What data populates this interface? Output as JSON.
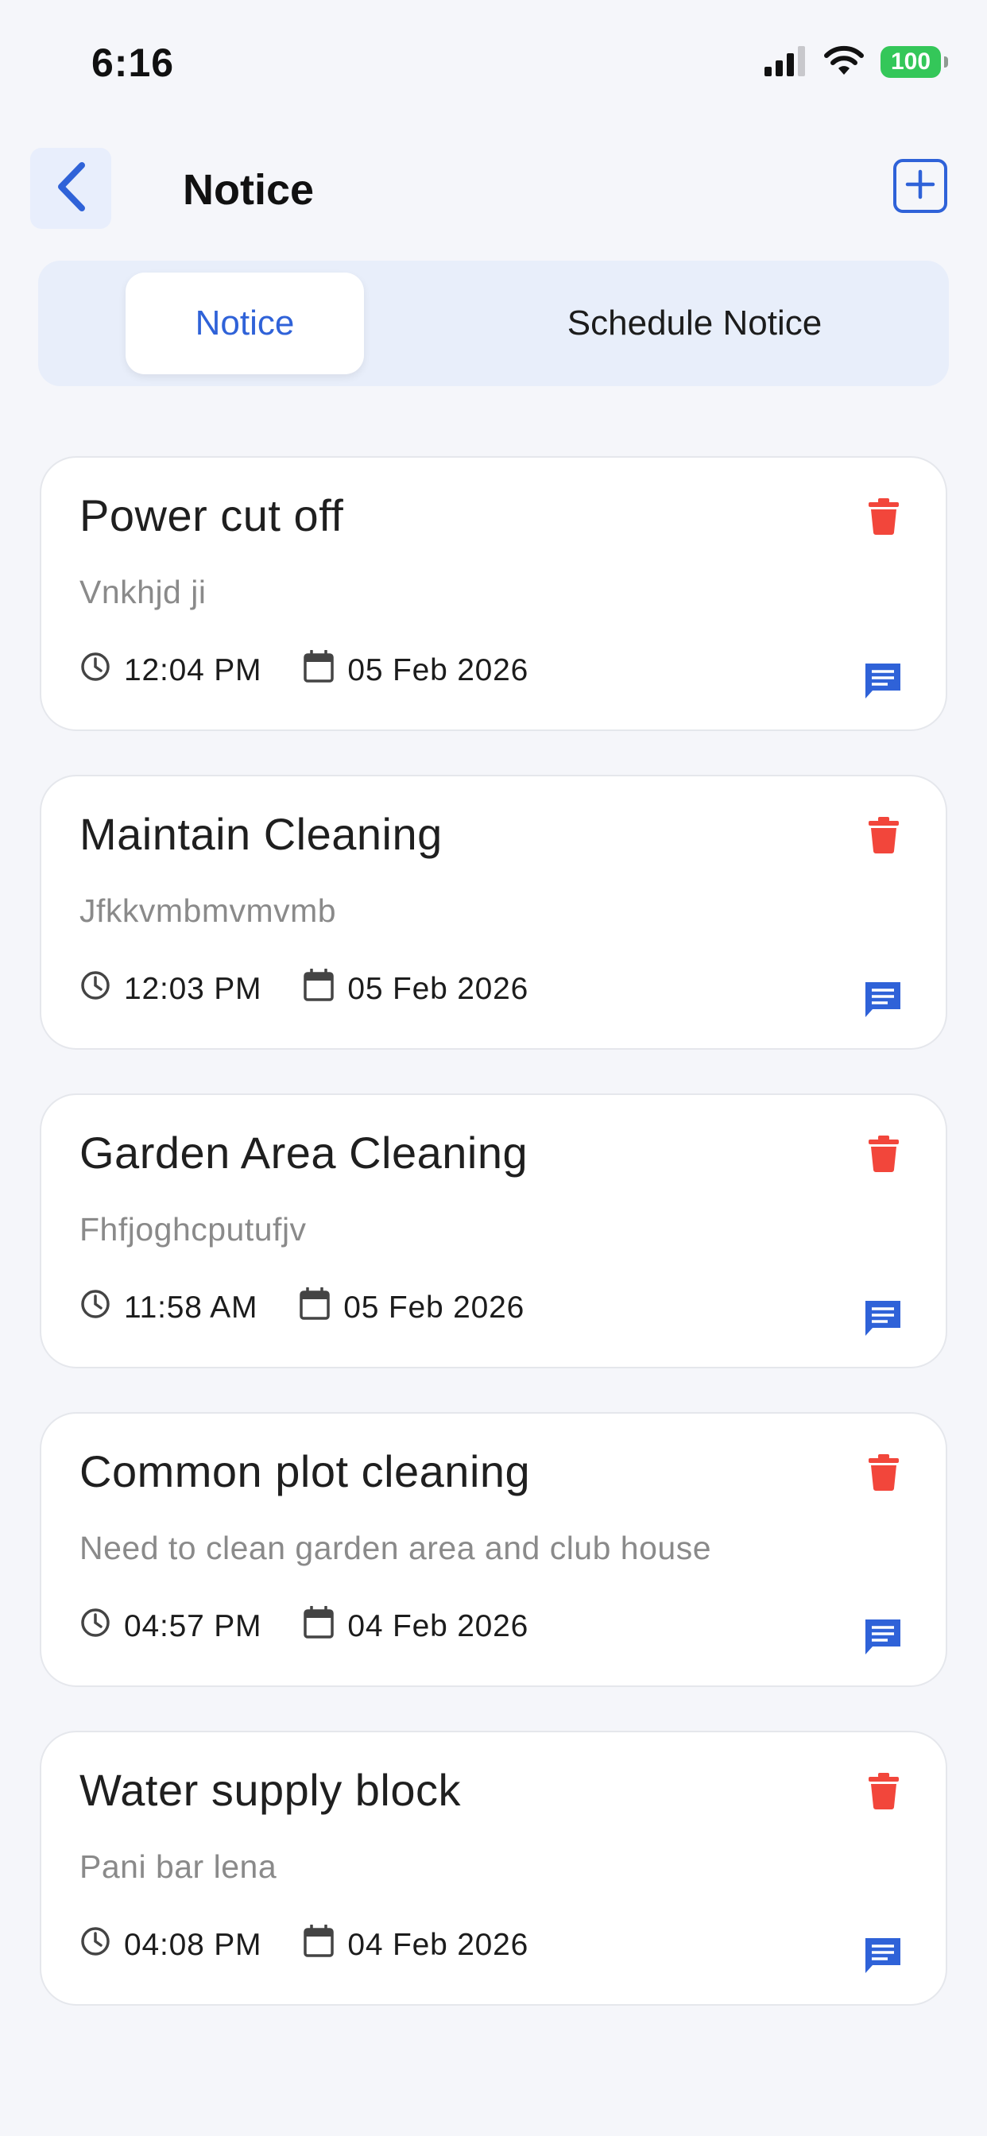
{
  "status_bar": {
    "time": "6:16",
    "battery": "100"
  },
  "header": {
    "title": "Notice",
    "back_icon": "chevron-left-icon",
    "add_icon": "plus-square-icon"
  },
  "tabs": [
    {
      "label": "Notice",
      "active": true
    },
    {
      "label": "Schedule Notice",
      "active": false
    }
  ],
  "notices": [
    {
      "title": "Power cut off",
      "description": "Vnkhjd ji",
      "time": "12:04 PM",
      "date": "05 Feb 2026"
    },
    {
      "title": "Maintain Cleaning",
      "description": "Jfkkvmbmvmvmb",
      "time": "12:03 PM",
      "date": "05 Feb 2026"
    },
    {
      "title": "Garden Area Cleaning",
      "description": "Fhfjoghcputufjv",
      "time": "11:58 AM",
      "date": "05 Feb 2026"
    },
    {
      "title": "Common plot cleaning",
      "description": "Need to clean garden area and club house",
      "time": "04:57 PM",
      "date": "04 Feb 2026"
    },
    {
      "title": "Water supply block",
      "description": "Pani bar lena",
      "time": "04:08 PM",
      "date": "04 Feb 2026"
    }
  ],
  "colors": {
    "accent": "#2f62d8",
    "delete": "#f2463b",
    "background": "#f5f6fa",
    "tab_background": "#e8eefa"
  }
}
